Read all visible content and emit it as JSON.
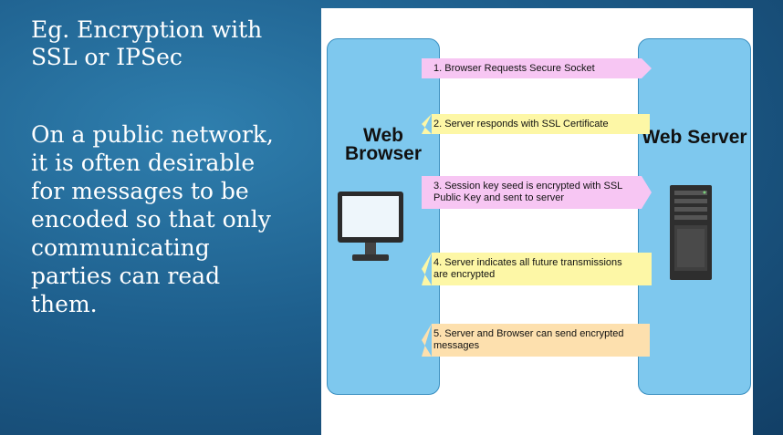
{
  "left_text": {
    "heading": "Eg. Encryption with SSL or IPSec",
    "body": "On a public network, it is often desirable for messages to be encoded so that only communicating parties can read them."
  },
  "diagram": {
    "browser_label": "Web Browser",
    "server_label": "Web Server",
    "steps": [
      {
        "text": "1. Browser Requests Secure Socket",
        "direction": "to-server",
        "color": "#f7c6f3"
      },
      {
        "text": "2. Server responds with SSL Certificate",
        "direction": "to-browser",
        "color": "#fdf7a6"
      },
      {
        "text": "3. Session key seed is encrypted with SSL Public Key and sent to server",
        "direction": "to-server",
        "color": "#f7c6f3"
      },
      {
        "text": "4. Server indicates all future transmissions are encrypted",
        "direction": "to-browser",
        "color": "#fdf7a6"
      },
      {
        "text": "5. Server and Browser can send encrypted messages",
        "direction": "both",
        "color": "#fde0ae"
      }
    ]
  }
}
